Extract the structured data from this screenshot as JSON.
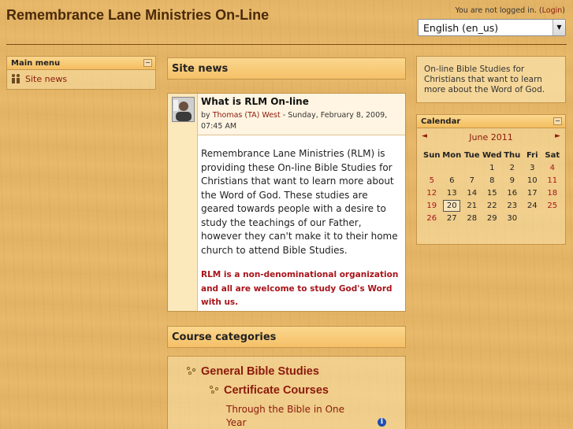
{
  "header": {
    "site_title": "Remembrance Lane Ministries On-Line",
    "login_text": "You are not logged in. (",
    "login_link": "Login",
    "login_close": ")",
    "language": "English (en_us)"
  },
  "main_menu": {
    "title": "Main menu",
    "hide_symbol": "−",
    "items": [
      {
        "label": "Site news",
        "icon": "forum-icon"
      }
    ]
  },
  "site_news": {
    "title": "Site news",
    "post": {
      "subject": "What is RLM On-line",
      "by": "by",
      "author": "Thomas (TA) West",
      "date": " - Sunday, February 8, 2009, 07:45 AM",
      "body": "Remembrance Lane Ministries (RLM) is providing these On-line Bible Studies for Christians that want to learn more about the Word of God. These studies are geared towards people with a desire to study the teachings of our Father, however they can't make it to their home church to attend Bible Studies.",
      "note": "RLM is a non-denominational organization and all are welcome to study God's Word with us."
    }
  },
  "course_categories": {
    "title": "Course categories",
    "category": "General Bible Studies",
    "subcategory": "Certificate Courses",
    "course": "Through the Bible in One Year",
    "info_symbol": "i"
  },
  "description": "On-line Bible Studies for Christians that want to learn more about the Word of God.",
  "calendar": {
    "title": "Calendar",
    "hide_symbol": "−",
    "prev": "◄",
    "next": "►",
    "month": "June 2011",
    "weekdays": [
      "Sun",
      "Mon",
      "Tue",
      "Wed",
      "Thu",
      "Fri",
      "Sat"
    ],
    "weeks": [
      [
        "",
        "",
        "",
        "1",
        "2",
        "3",
        "4"
      ],
      [
        "5",
        "6",
        "7",
        "8",
        "9",
        "10",
        "11"
      ],
      [
        "12",
        "13",
        "14",
        "15",
        "16",
        "17",
        "18"
      ],
      [
        "19",
        "20",
        "21",
        "22",
        "23",
        "24",
        "25"
      ],
      [
        "26",
        "27",
        "28",
        "29",
        "30",
        "",
        ""
      ]
    ],
    "today": "20"
  },
  "colors": {
    "link": "#8b1a0c",
    "highlight_text": "#a8141a",
    "block_header": "#f4be60"
  }
}
